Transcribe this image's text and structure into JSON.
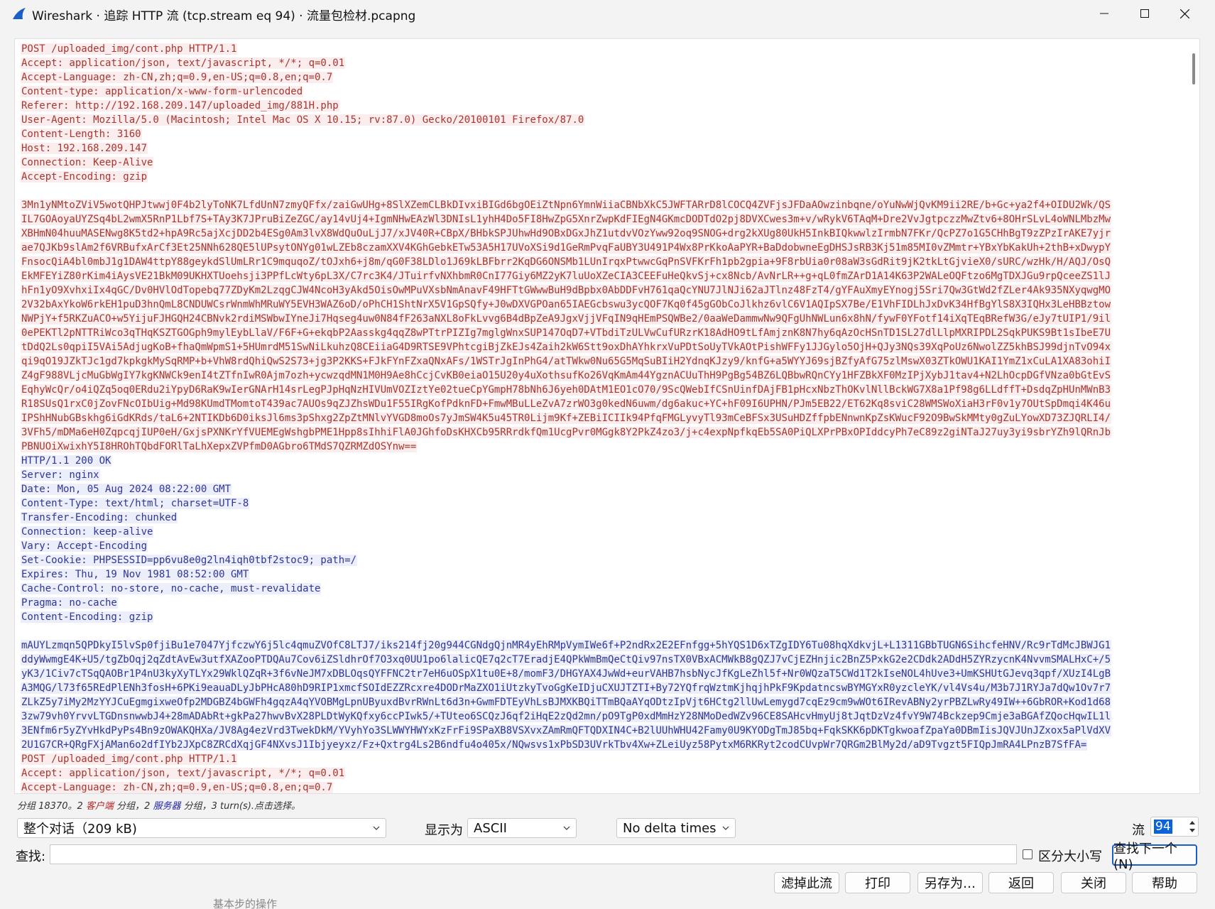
{
  "window": {
    "title": "Wireshark · 追踪 HTTP 流 (tcp.stream eq 94) · 流量包检材.pcapng",
    "accent_color": "#1a5fc8"
  },
  "stream": {
    "client_color": "#a8362f",
    "client_bg": "#fbeded",
    "server_color": "#2e3796",
    "server_bg": "#edeefb",
    "lines": [
      {
        "t": "POST /uploaded_img/cont.php HTTP/1.1",
        "d": "c"
      },
      {
        "t": "Accept: application/json, text/javascript, */*; q=0.01",
        "d": "c"
      },
      {
        "t": "Accept-Language: zh-CN,zh;q=0.9,en-US;q=0.8,en;q=0.7",
        "d": "c"
      },
      {
        "t": "Content-type: application/x-www-form-urlencoded",
        "d": "c"
      },
      {
        "t": "Referer: http://192.168.209.147/uploaded_img/881H.php",
        "d": "c"
      },
      {
        "t": "User-Agent: Mozilla/5.0 (Macintosh; Intel Mac OS X 10.15; rv:87.0) Gecko/20100101 Firefox/87.0",
        "d": "c"
      },
      {
        "t": "Content-Length: 3160",
        "d": "c"
      },
      {
        "t": "Host: 192.168.209.147",
        "d": "c"
      },
      {
        "t": "Connection: Keep-Alive",
        "d": "c"
      },
      {
        "t": "Accept-Encoding: gzip",
        "d": "c"
      },
      {
        "t": "",
        "d": "b"
      },
      {
        "t": "3Mn1yNMtoZViV5wotQHPJtwwj0F4b2lyToNK7LfdUnN7zmyQFfx/zaiGwUHg+8SlXZemCLBkDIvxiBIGd6bgOEiZtNpn6YmnWiiaCBNbXkC5JWFTARrD8lCOCQ4ZVFjsJFDaAOwzinbqne/oYuNwWjQvKM9ii2RE/b+Gc+ya2f4+OIDU2Wk/QS",
        "d": "c"
      },
      {
        "t": "IL7GOAoyaUYZSq4bL2wmX5RnP1Lbf7S+TAy3K7JPruBiZeZGC/ay14vUj4+IgmNHwEAzWl3DNIsL1yhH4Do5FI8HwZpG5XnrZwpKdFIEgN4GKmcDODTdO2pj8DVXCwes3m+v/wRykV6TAqM+Dre2VvJgtpczzMwZtv6+8OHrSLvL4oWNLMbzMw",
        "d": "c"
      },
      {
        "t": "XBHmN04huuMASENwg8K5td2+hpA9Rc5ajXcjDD2b4ESg0Am3lvX8WdQuOuLjJ7/xJV40R+CBpX/BHbkSPJUhwHd9OBxDGxJhZ1utdvVOzYww92oq9SNOG+drg2kXUg80UkH5InkBIQkwwlzIrmbN7FKr/QcPZ7o1G5CHhBgT9zZPzIrAKE7yjr",
        "d": "c"
      },
      {
        "t": "ae7QJKb9slAm2f6VRBufxArCf3Et25NNh628QE5lUPsytONYg01wLZEb8czamXXV4KGhGebkETw53A5H17UVoXSi9d1GeRmPvqFaUBY3U491P4Wx8PrKkoAaPYR+BaDdobwneEgDHSJsRB3Kj51m85MI0vZMmtr+YBxYbKakUh+2thB+xDwypY",
        "d": "c"
      },
      {
        "t": "FnsocQiA4bl0mbJ1g1DAW4ttpY88geykdSlUmLRr1C9mquqoZ/tOJxh6+j8m/qG0F38LDlo1J69kLBFbrr2KqDG6ONSMb1LUnIrqxPtwwcGqPnSVFKrFh1pb2gpia+9F8rbUia0r08aW3sGdRit9jK2tkLtGjvieX0/sURC/wzHk/H/AQJ/OsQ",
        "d": "c"
      },
      {
        "t": "EkMFEYiZ80rKim4iAysVE21BkM09UKHXTUoehsji3PPfLcWty6pL3X/C7rc3K4/JTuirfvNXhbmR0CnI77Giy6MZ2yK7luUoXZeCIA3CEEFuHeQkvSj+cx8Ncb/AvNrLR++g+qL0fmZArD1A14K63P2WALeOQFtzo6MgTDXJGu9rpQceeZS1lJ",
        "d": "c"
      },
      {
        "t": "hFn1yO9XvhxiIx4qGC/Dv0HVlOdTopebq77ZDyKm2LzqgCJW4NcoH3yAkd5OisOwMPuVXsbNmAnavF49HFTtGWwwBuH9dBpbx0AbDDFvH761qaQcYNU7JlNJi62aJTlnz48FzT4/gYFAuXmyEYnogj5Sri7Qw3GtWd2fZLer4Ak935NXyqwgMO",
        "d": "c"
      },
      {
        "t": "2V32bAxYkoW6rkEH1puD3hnQmL8CNDUWCsrWnmWhMRuWY5EVH3WAZ6oD/oPhCH1ShtNrX5V1GpSQfy+J0wDXVGPOan65IAEGcbswu3ycQOF7Kq0f45gGObCoJlkhz6vlC6V1AQIpSX7Be/E1VhFIDLhJxDvK34HfBgYlS8X3IQHx3LeHBBztow",
        "d": "c"
      },
      {
        "t": "NWPjY+f5RKZuACO+w5YijuFJHGQH24CBNvk2rdiMSWbwIYneJi7Hqseg4uw0N84fF263aNXL8oFkLvvg6B4dBpZeA9JgxVjjVFqIN9qHEmPSQWBe2/0aaWeDammwNw9QFgUhNWLun6x8hN/fywF0YFotf14iXqTEqBRefW3G/eJy7tUIP1/9il",
        "d": "c"
      },
      {
        "t": "0ePEKTl2pNTTRiWco3qTHqKSZTGOGph9mylEybLlaV/F6F+G+ekqbP2Aasskg4qqZ8wPTtrPIZIg7mglgWnxSUP147OqD7+VTbdiTzULVwCufURzrK18AdHO9tLfAmjznK8N7hy6qAzOcHSnTD1SL27dlLlpMXRIPDL2SqkPUKS9Bt1sIbeE7U",
        "d": "c"
      },
      {
        "t": "tDdQ2Ls0qpiI5VAi5AdjugKoB+fhaQmWpmS1+5HUmrdM51SwNiLkuhzQ8CEiiaG4D9RTSE9VPhtcgiBjZkEJs4Zaih2kW6Stt9oxDhAYhkrxVuPDtSoUyTVkAOtPishWFFy1JJGylo5OjH+QJy3NQs39XqPoUz6NwolZZ5khBSJ99djnTvO94x",
        "d": "c"
      },
      {
        "t": "qi9qO19JZkTJc1gd7kpkgkMySqRMP+b+VhW8rdQhiQwS2S73+jg3P2KKS+FJkFYnFZxaQNxAFs/1WSTrJgInPhG4/atTWkw0Nu65G5MqSuBIiH2YdnqKJzy9/knfG+a5WYYJ69sjBZfyAfG75zlMswX03ZTkOWU1KAI1YmZ1xCuLA1XA83ohiI",
        "d": "c"
      },
      {
        "t": "Z4gF988VLjcMuGbWgIY7kgKNWCk9enI4tZTfnIwR0Ajm7ozh+ycwzqdMN1M0H9Ae8hCcjCvKB0eiaO15U20y4uXothsufKo26VqKmAm44YgznACUuThH9PgBg54BZ6LQBbwRQnCYy1HFZBkXF0MzIPjXybJ1tav4+N2LhOcpDGfVNza0bGtEvS",
        "d": "c"
      },
      {
        "t": "EqhyWcQr/o4iQZq5oq0ERdu2iYpyD6RaK9wIerGNArH14srLegPJpHqNzHIVUmVOZIztYe02tueCpYGmpH78bNh6J6yeh0DAtM1EO1cO70/9ScQWebIfCSnUinfDAjFB1pHcxNbzThOKvlNllBckWG7X8a1Pf98g6LLdffT+DsdqZpHUnMWnB3",
        "d": "c"
      },
      {
        "t": "R18SUsQ1rxC0jZovFNcOIbUig+Md98KUmdTMomtoT439ac7AUOs9qZJZhsWDu1F55IRgKofPdknFD+FmwMBuLLeZvA7zrWO3g0kedN6uwm/dg6akuc+YC+hF09I6UPHN/PJm5EB22/ET62Kq8sviC28WMSWoXiaH3rF0v1y7OUtSpDmqi4K46u",
        "d": "c"
      },
      {
        "t": "IPShHNubGBskhg6iGdKRds/taL6+2NTIKDb6D0iksJl6ms3pShxg2ZpZtMNlvYVGD8moOs7yJmSW4K5u45TR0Lijm9Kf+ZEBiICIIk94PfqFMGLyvyTl93mCeBFSx3USuHDZffpbENnwnKpZsKWucF92O9BwSkMMty0gZuLYowXD73ZJQRLI4/",
        "d": "c"
      },
      {
        "t": "3VFh5/mDMa6eH0ZqpcqjIUP0eH/GxjsPXNKrYfVUEMEgWshgbPME1Hpp8sIhhiFlA0JGhfoDsKHXCb95RRrdkfQm1UcgPvr0MGgk8Y2PkZ4zo3/j+c4expNpfkqEb5SA0PiQLXPrPBxOPIddcyPh7eC89z2giNTaJ27uy3yi9sbrYZh9lQRnJb",
        "d": "c"
      },
      {
        "t": "PBNUOiXwixhY5I8HROhTQbdFORlTaLhXepxZVPfmD0AGbro6TMdS7QZRMZdOSYnw==",
        "d": "c"
      },
      {
        "t": "HTTP/1.1 200 OK",
        "d": "s"
      },
      {
        "t": "Server: nginx",
        "d": "s"
      },
      {
        "t": "Date: Mon, 05 Aug 2024 08:22:00 GMT",
        "d": "s"
      },
      {
        "t": "Content-Type: text/html; charset=UTF-8",
        "d": "s"
      },
      {
        "t": "Transfer-Encoding: chunked",
        "d": "s"
      },
      {
        "t": "Connection: keep-alive",
        "d": "s"
      },
      {
        "t": "Vary: Accept-Encoding",
        "d": "s"
      },
      {
        "t": "Set-Cookie: PHPSESSID=pp6vu8e0g2ln4iqh0tbf2stoc9; path=/",
        "d": "s"
      },
      {
        "t": "Expires: Thu, 19 Nov 1981 08:52:00 GMT",
        "d": "s"
      },
      {
        "t": "Cache-Control: no-store, no-cache, must-revalidate",
        "d": "s"
      },
      {
        "t": "Pragma: no-cache",
        "d": "s"
      },
      {
        "t": "Content-Encoding: gzip",
        "d": "s"
      },
      {
        "t": "",
        "d": "b"
      },
      {
        "t": "mAUYLzmqn5QPDkyI5lvSp0fjiBu1e7047YjfczwY6j5lc4qmuZVOfC8LTJ7/iks214fj20g944CGNdgQjnMR4yEhRMpVymIWe6f+P2ndRx2E2EFnfgg+5hYQS1D6xTZgIDY6Tu08hqXdkvjL+L1311GBbTUGN6SihcfeHNV/Rc9rTdMcJBWJG1",
        "d": "s"
      },
      {
        "t": "ddyWwmgE4K+U5/tgZbOqj2qZdtAvEw3utfXAZooPTDQAu7Cov6iZSldhrOf7O3xq0UU1po6lalicQE7q2cT7EradjE4QPkWmBmQeCtQiv97nsTX0VBxACMWkB8gQZJ7vCjEZHnjic2BnZ5PxkG2e2CDdk2ADdH5ZYRzycnK4NvvmSMALHxC+/5",
        "d": "s"
      },
      {
        "t": "yK3/1Civ7cTSqQAOBr1P4nU3kyXyTLYx29WklQZqR+3f6vNeJM7xDBLOqsQYFFNC2tr7eH6uOSpX1tu0E+8/momF3/DHGYAX4JwWd+eurVAHB7hsbNycJfKgLeZhl5f+Nr0WQzaT5CWd1T2kIseNOL4hUve3+UmKSHUtGJevq3qpf/XUzI4LgB",
        "d": "s"
      },
      {
        "t": "A3MQG/l73f65REdPlENh3fosH+6PKi9eauaDLyJbPHcA80hD9RIP1xmcfSOIdEZZRcxre4DODrMaZXO1iUtzkyTvoGgKeIDjuCXUJTZTI+By72YQfrqWztmKjhqjhPkF9KpdatncswBYMGYxR0yzcleYK/vl4Vs4u/M3b7J1RYJa7dQw1Ov7r7",
        "d": "s"
      },
      {
        "t": "ZLkZ5y7iMy2MzYYJCuEgmgixweOfp2MDGBZ4bGWFh4gqzA4qYVOBMgLpnUByuxdBvrRWnLt6d3n+GwmFDTEyVhLsBJMXKBQiTTmBQaAYqODtzIpVjt6HCtg2llUwLemygd7cqEz9cm9wWOt6IRevABNy2yrPBZLwRy49IW++6GbROR+Kod1d68",
        "d": "s"
      },
      {
        "t": "3zw79vh0YrvvLTGDnsnwwbJ4+28mADAbRt+gkPa27hwvBvX28PLDtWyKQfxy6ccPIwk5/+TUteo6SCQzJ6qf2iHqE2zQd2mn/pO9TgP0xdMmHzY28NMoDedWZv96CE8SAHcvHmyUj8tJqtDzVz4fvY9W74Bckzep9Cmje3aBGAfZQocHqwIL1l",
        "d": "s"
      },
      {
        "t": "3ENfm6r5yZYvHkdPyPs4Bn9zOWAKQHXa/JV8Ag4ezVrd3TwekDkM/YVyhYo3SLWWYHWYxKzFrFi9SPaXB8VSXvxZAmRmQFTQDXIN4C+B2lUUhWHU42Famy0U9KYODgTmJ85bq+FqkSKK6pDKTgkwoafZpaYa0DBmIisJQVJUnJZxox5aPlVdXV",
        "d": "s"
      },
      {
        "t": "2U1G7CR+QRgFXjAMan6o2dfIYb2JXpC8ZRCdXqjGF4NXvsJ1Ibjyeyxz/Fz+Qxtrg4Ls2B6ndfu4o405x/NQwsvs1xPbSD3UVrkTbv4Xw+ZLeiUyz58PytxM6RKRyt2codCUvpWr7QRGm2BlMy2d/aD9Tvgzt5FIQpJmRA4LPnzB7SfFA=",
        "d": "s"
      },
      {
        "t": "POST /uploaded_img/cont.php HTTP/1.1",
        "d": "c"
      },
      {
        "t": "Accept: application/json, text/javascript, */*; q=0.01",
        "d": "c"
      },
      {
        "t": "Accept-Language: zh-CN,zh;q=0.9,en-US;q=0.8,en;q=0.7",
        "d": "c"
      }
    ]
  },
  "status": {
    "packet_prefix": "分组 18370。",
    "client_count": "2",
    "client_word": "客户端",
    "mid1": " 分组，",
    "server_count": "2",
    "server_word": "服务器",
    "mid2": " 分组，3 turn(s).点击选择。"
  },
  "controls": {
    "conversation_select": "整个对话（209 kB)",
    "show_as_label": "显示为",
    "show_as_value": "ASCII",
    "delta_select": "No delta times",
    "stream_label": "流",
    "stream_value": "94",
    "find_label": "查找:",
    "find_value": "",
    "case_label": "区分大小写",
    "find_next": "查找下一个(N)"
  },
  "buttons": {
    "filter_out": "滤掉此流",
    "print": "打印",
    "save_as": "另存为…",
    "back": "返回",
    "close": "关闭",
    "help": "帮助"
  },
  "background_hint": "基本步的操作"
}
